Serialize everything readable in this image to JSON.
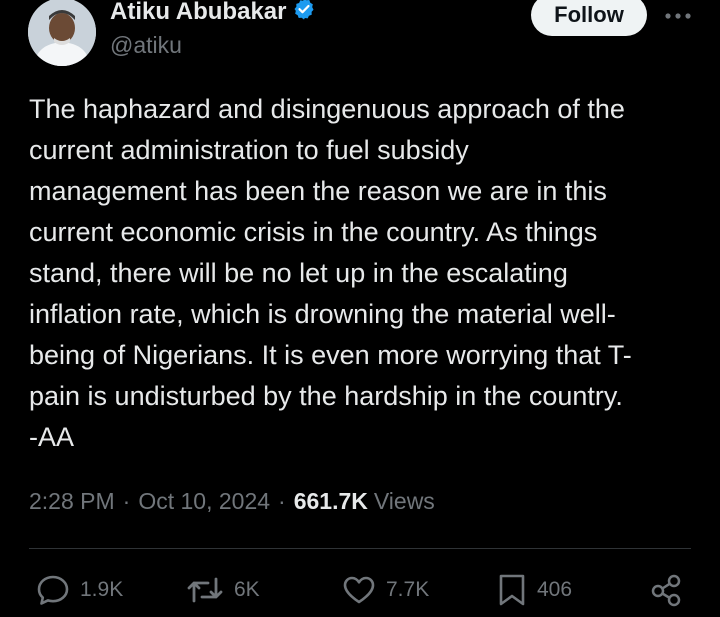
{
  "author": {
    "name": "Atiku Abubakar",
    "handle": "@atiku",
    "verified": true
  },
  "follow_label": "Follow",
  "tweet_lines": [
    "The haphazard and disingenuous approach of the",
    "current administration to fuel subsidy",
    "management has been the reason we are in this",
    "current economic crisis in the country. As things",
    "stand, there will be no let up in the escalating",
    "inflation rate, which is drowning the material well-",
    "being of Nigerians. It is even more worrying that T-",
    "pain is undisturbed by the hardship in the country.",
    "-AA"
  ],
  "meta": {
    "time": "2:28 PM",
    "separator": "·",
    "date": "Oct 10, 2024",
    "views_count": "661.7K",
    "views_label": "Views"
  },
  "actions": {
    "replies": "1.9K",
    "reposts": "6K",
    "likes": "7.7K",
    "bookmarks": "406"
  },
  "colors": {
    "background": "#000000",
    "text": "#e7e9ea",
    "secondary": "#71767b",
    "verified": "#1d9bf0",
    "divider": "#2f3336"
  },
  "icons": [
    "verified-badge-icon",
    "more-icon",
    "reply-icon",
    "repost-icon",
    "like-icon",
    "bookmark-icon",
    "share-icon"
  ]
}
